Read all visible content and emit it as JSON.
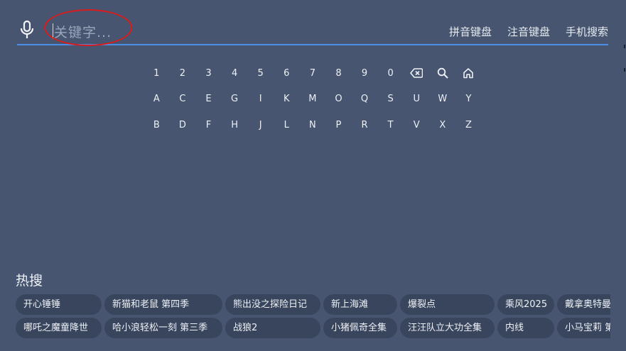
{
  "search": {
    "placeholder": "关键字..."
  },
  "keyboard_modes": [
    "拼音键盘",
    "注音键盘",
    "手机搜索"
  ],
  "keyboard": {
    "rows": [
      [
        "1",
        "2",
        "3",
        "4",
        "5",
        "6",
        "7",
        "8",
        "9",
        "0",
        "backspace-icon",
        "search-icon",
        "home-icon"
      ],
      [
        "A",
        "C",
        "E",
        "G",
        "I",
        "K",
        "M",
        "O",
        "Q",
        "S",
        "U",
        "W",
        "Y"
      ],
      [
        "B",
        "D",
        "F",
        "H",
        "J",
        "L",
        "N",
        "P",
        "R",
        "T",
        "V",
        "X",
        "Z"
      ]
    ]
  },
  "hot_search": {
    "title": "热搜",
    "rows": [
      [
        "开心锤锤",
        "新猫和老鼠 第四季",
        "熊出没之探险日记",
        "新上海滩",
        "爆裂点",
        "乘风2025",
        "戴拿奥特曼"
      ],
      [
        "哪吒之魔童降世",
        "哈小浪轻松一刻 第三季",
        "战狼2",
        "小猪佩奇全集",
        "汪汪队立大功全集",
        "内线",
        "小马宝莉 第九季"
      ]
    ]
  },
  "colors": {
    "background": "#475570",
    "chip": "#38455c",
    "underline": "#4a8fe6",
    "annotation": "#d91c1c"
  }
}
